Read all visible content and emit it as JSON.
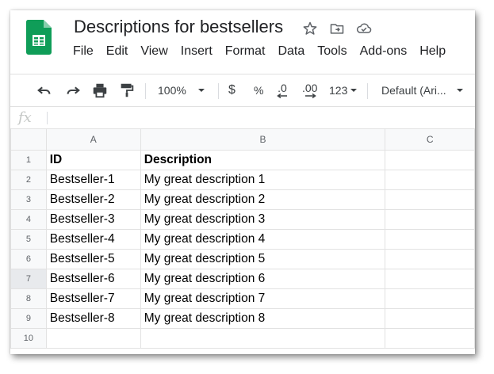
{
  "doc": {
    "title": "Descriptions for bestsellers"
  },
  "menu": [
    "File",
    "Edit",
    "View",
    "Insert",
    "Format",
    "Data",
    "Tools",
    "Add-ons",
    "Help"
  ],
  "toolbar": {
    "zoom": "100%",
    "currency": "$",
    "percent": "%",
    "decrease_decimal": ".0",
    "increase_decimal": ".00",
    "number_format": "123",
    "font": "Default (Ari..."
  },
  "formula_bar": {
    "fx": "fx",
    "value": ""
  },
  "columns": [
    "A",
    "B",
    "C"
  ],
  "rows": [
    {
      "num": "1",
      "a": "ID",
      "b": "Description",
      "c": ""
    },
    {
      "num": "2",
      "a": "Bestseller-1",
      "b": "My great description 1",
      "c": ""
    },
    {
      "num": "3",
      "a": "Bestseller-2",
      "b": "My great description 2",
      "c": ""
    },
    {
      "num": "4",
      "a": "Bestseller-3",
      "b": "My great description 3",
      "c": ""
    },
    {
      "num": "5",
      "a": "Bestseller-4",
      "b": "My great description 4",
      "c": ""
    },
    {
      "num": "6",
      "a": "Bestseller-5",
      "b": "My great description 5",
      "c": ""
    },
    {
      "num": "7",
      "a": "Bestseller-6",
      "b": "My great description 6",
      "c": ""
    },
    {
      "num": "8",
      "a": "Bestseller-7",
      "b": "My great description 7",
      "c": ""
    },
    {
      "num": "9",
      "a": "Bestseller-8",
      "b": "My great description 8",
      "c": ""
    },
    {
      "num": "10",
      "a": "",
      "b": "",
      "c": ""
    }
  ],
  "colors": {
    "sheets_green": "#0f9d58",
    "header_bg": "#f8f9fa",
    "grid_line": "#e2e2e2"
  }
}
